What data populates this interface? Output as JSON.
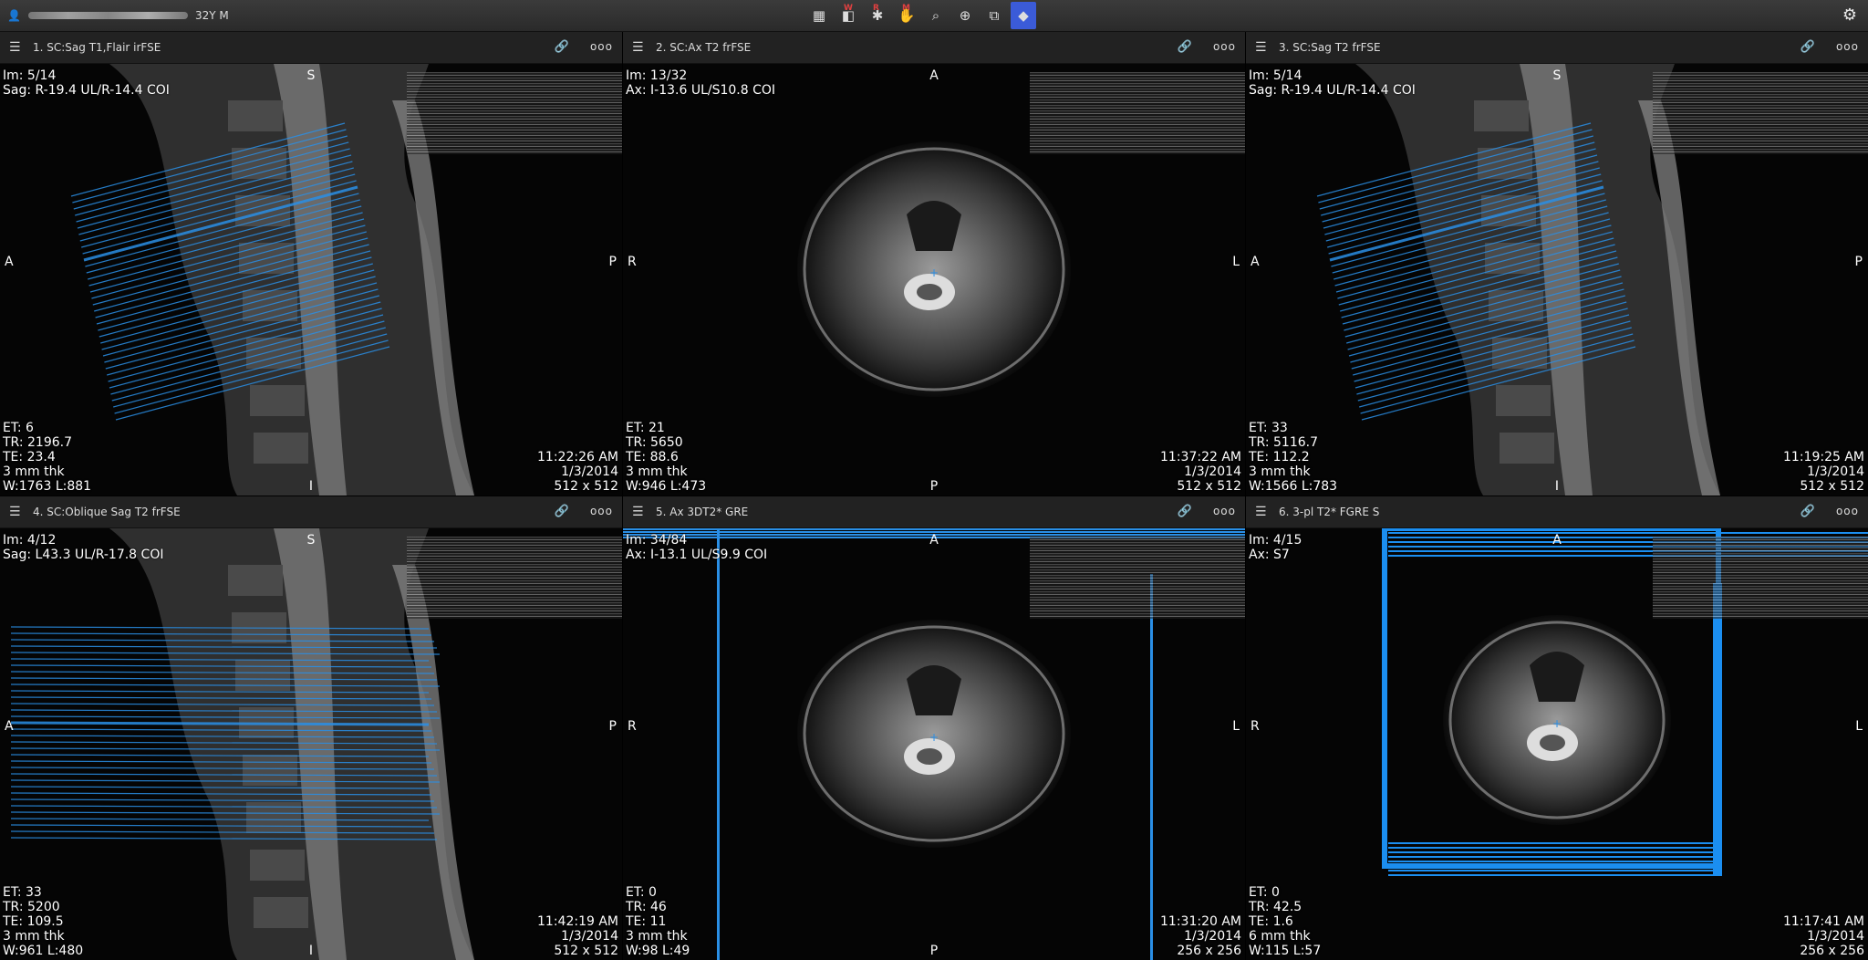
{
  "topbar": {
    "patient_info": "32Y M",
    "tools": [
      {
        "icon": "grid-icon",
        "glyph": "▦",
        "badge": ""
      },
      {
        "icon": "window-level-icon",
        "glyph": "◧",
        "badge": "W"
      },
      {
        "icon": "reset-icon",
        "glyph": "✱",
        "badge": "R"
      },
      {
        "icon": "hand-icon",
        "glyph": "✋",
        "badge": "M"
      },
      {
        "icon": "zoom-icon",
        "glyph": "⌕",
        "badge": ""
      },
      {
        "icon": "crosshair-icon",
        "glyph": "⊕",
        "badge": ""
      },
      {
        "icon": "stack-icon",
        "glyph": "⧉",
        "badge": ""
      },
      {
        "icon": "cube-icon",
        "glyph": "◆",
        "badge": ""
      }
    ]
  },
  "viewports": [
    {
      "title": "1. SC:Sag T1,Flair irFSE",
      "im": "Im: 5/14",
      "pos": "Sag: R-19.4 UL/R-14.4 COI",
      "et": "ET: 6",
      "tr": "TR: 2196.7",
      "te": "TE: 23.4",
      "thk": "3 mm thk",
      "wl": "W:1763 L:881",
      "time": "11:22:26 AM",
      "date": "1/3/2014",
      "matrix": "512 x 512",
      "top": "S",
      "bottom": "I",
      "left": "A",
      "right": "P",
      "type": "sag"
    },
    {
      "title": "2. SC:Ax T2 frFSE",
      "im": "Im: 13/32",
      "pos": "Ax: I-13.6 UL/S10.8 COI",
      "et": "ET: 21",
      "tr": "TR: 5650",
      "te": "TE: 88.6",
      "thk": "3 mm thk",
      "wl": "W:946 L:473",
      "time": "11:37:22 AM",
      "date": "1/3/2014",
      "matrix": "512 x 512",
      "top": "A",
      "bottom": "P",
      "left": "R",
      "right": "L",
      "type": "ax"
    },
    {
      "title": "3. SC:Sag T2 frFSE",
      "im": "Im: 5/14",
      "pos": "Sag: R-19.4 UL/R-14.4 COI",
      "et": "ET: 33",
      "tr": "TR: 5116.7",
      "te": "TE: 112.2",
      "thk": "3 mm thk",
      "wl": "W:1566 L:783",
      "time": "11:19:25 AM",
      "date": "1/3/2014",
      "matrix": "512 x 512",
      "top": "S",
      "bottom": "I",
      "left": "A",
      "right": "P",
      "type": "sag"
    },
    {
      "title": "4. SC:Oblique Sag T2 frFSE",
      "im": "Im: 4/12",
      "pos": "Sag: L43.3 UL/R-17.8 COI",
      "et": "ET: 33",
      "tr": "TR: 5200",
      "te": "TE: 109.5",
      "thk": "3 mm thk",
      "wl": "W:961 L:480",
      "time": "11:42:19 AM",
      "date": "1/3/2014",
      "matrix": "512 x 512",
      "top": "S",
      "bottom": "I",
      "left": "A",
      "right": "P",
      "type": "sag2"
    },
    {
      "title": "5. Ax 3DT2* GRE",
      "im": "Im: 34/84",
      "pos": "Ax: I-13.1 UL/S9.9 COI",
      "et": "ET: 0",
      "tr": "TR: 46",
      "te": "TE: 11",
      "thk": "3 mm thk",
      "wl": "W:98 L:49",
      "time": "11:31:20 AM",
      "date": "1/3/2014",
      "matrix": "256 x 256",
      "top": "A",
      "bottom": "P",
      "left": "R",
      "right": "L",
      "type": "ax2"
    },
    {
      "title": "6. 3-pl T2* FGRE S",
      "im": "Im: 4/15",
      "pos": "Ax: S7",
      "et": "ET: 0",
      "tr": "TR: 42.5",
      "te": "TE: 1.6",
      "thk": "6 mm thk",
      "wl": "W:115 L:57",
      "time": "11:17:41 AM",
      "date": "1/3/2014",
      "matrix": "256 x 256",
      "top": "A",
      "bottom": "",
      "left": "R",
      "right": "L",
      "type": "ax3"
    }
  ]
}
